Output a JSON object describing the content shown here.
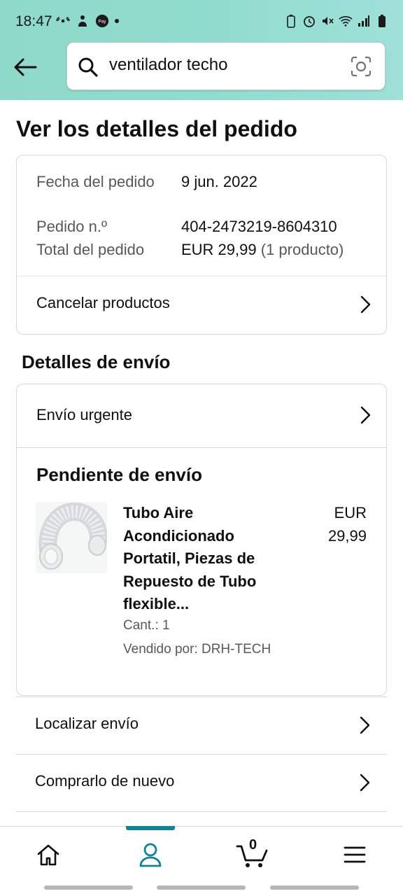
{
  "status": {
    "time": "18:47",
    "left_icons": [
      "wifi-calling-icon",
      "usb-tethering-icon",
      "pay-icon",
      "notification-dot-icon"
    ],
    "right_icons": [
      "battery-saver-icon",
      "alarm-icon",
      "mute-icon",
      "wifi-icon",
      "signal-icon",
      "battery-icon"
    ]
  },
  "search": {
    "value": "ventilador techo"
  },
  "page": {
    "title": "Ver los detalles del pedido"
  },
  "order": {
    "date_label": "Fecha del pedido",
    "date_value": "9 jun. 2022",
    "number_label": "Pedido n.º",
    "number_value": "404-2473219-8604310",
    "total_label": "Total del pedido",
    "total_value": "EUR 29,99",
    "total_count": "(1 producto)",
    "cancel_label": "Cancelar productos"
  },
  "shipping": {
    "section_title": "Detalles de envío",
    "method": "Envío urgente",
    "status_title": "Pendiente de envío",
    "product": {
      "title": "Tubo Aire Acondicionado Portatil, Piezas de Repuesto de Tubo flexible...",
      "price_currency": "EUR",
      "price_value": "29,99",
      "quantity": "Cant.: 1",
      "seller": "Vendido por: DRH-TECH"
    }
  },
  "actions": {
    "track": "Localizar envío",
    "buy_again": "Comprarlo de nuevo"
  },
  "nav": {
    "items": [
      "home-icon",
      "account-icon",
      "cart-icon",
      "menu-icon"
    ],
    "active": "account-icon",
    "cart_count": "0"
  },
  "colors": {
    "header_bg": "#90dccd",
    "accent": "#118394",
    "text": "#0f1111",
    "muted": "#565959"
  }
}
